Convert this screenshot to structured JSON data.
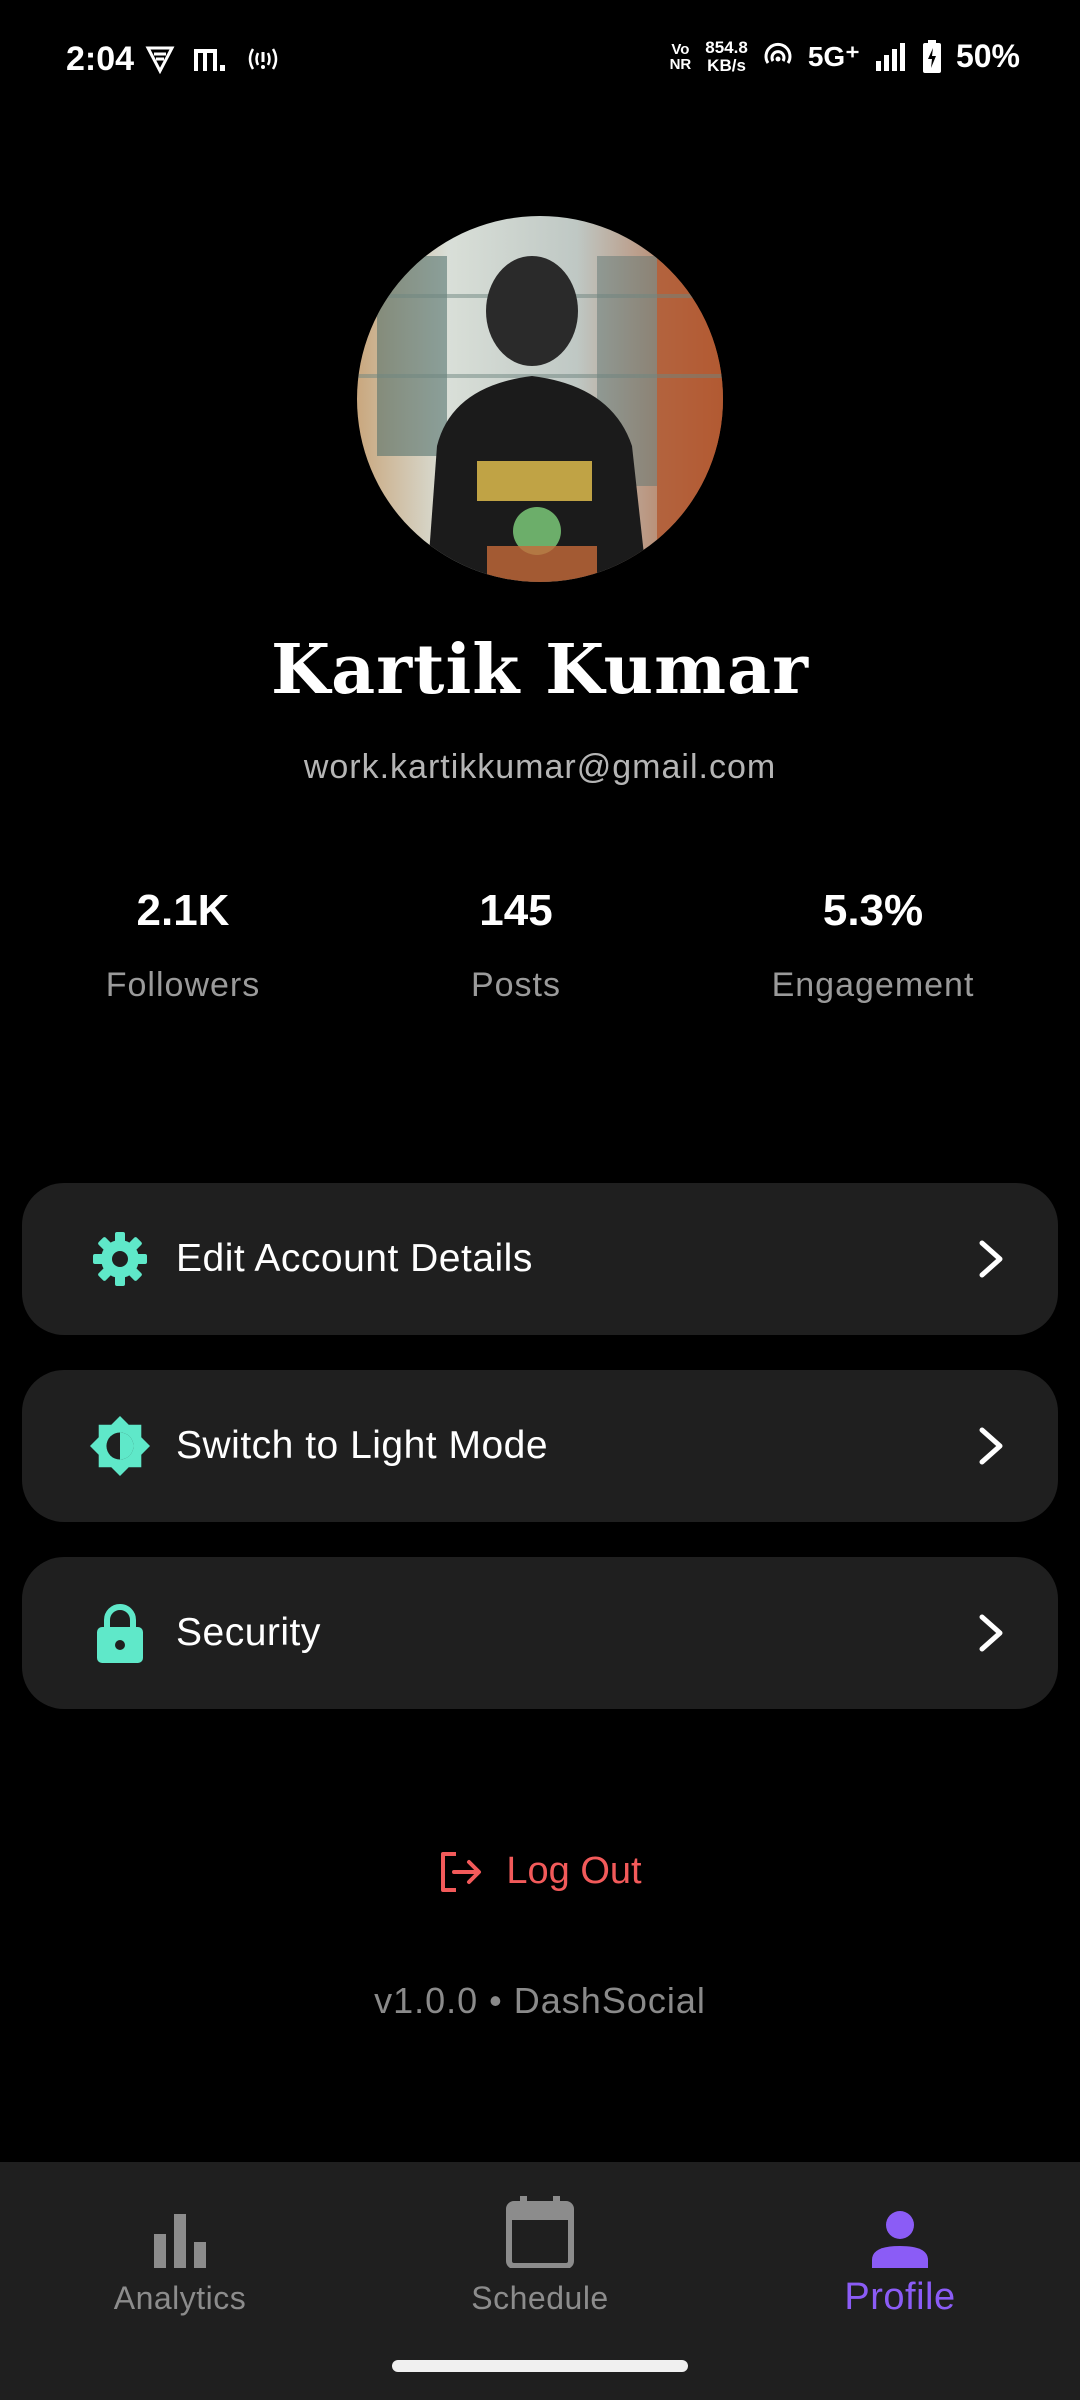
{
  "status_bar": {
    "time": "2:04",
    "volte_top": "Vo",
    "volte_bottom": "NR",
    "speed_value": "854.8",
    "speed_unit": "KB/s",
    "network": "5G⁺",
    "battery": "50%"
  },
  "profile": {
    "name": "Kartik Kumar",
    "email": "work.kartikkumar@gmail.com"
  },
  "stats": [
    {
      "value": "2.1K",
      "label": "Followers"
    },
    {
      "value": "145",
      "label": "Posts"
    },
    {
      "value": "5.3%",
      "label": "Engagement"
    }
  ],
  "menu": [
    {
      "label": "Edit Account Details",
      "icon": "gear-icon"
    },
    {
      "label": "Switch to Light Mode",
      "icon": "brightness-icon"
    },
    {
      "label": "Security",
      "icon": "lock-icon"
    }
  ],
  "logout_label": "Log Out",
  "version": "v1.0.0 • DashSocial",
  "nav": [
    {
      "label": "Analytics",
      "icon": "bar-chart-icon",
      "active": false
    },
    {
      "label": "Schedule",
      "icon": "calendar-icon",
      "active": false
    },
    {
      "label": "Profile",
      "icon": "person-icon",
      "active": true
    }
  ],
  "colors": {
    "accent_teal": "#5fe8c9",
    "accent_purple": "#8b5cf6",
    "danger": "#f25a5a",
    "card": "#1f1f1f"
  }
}
